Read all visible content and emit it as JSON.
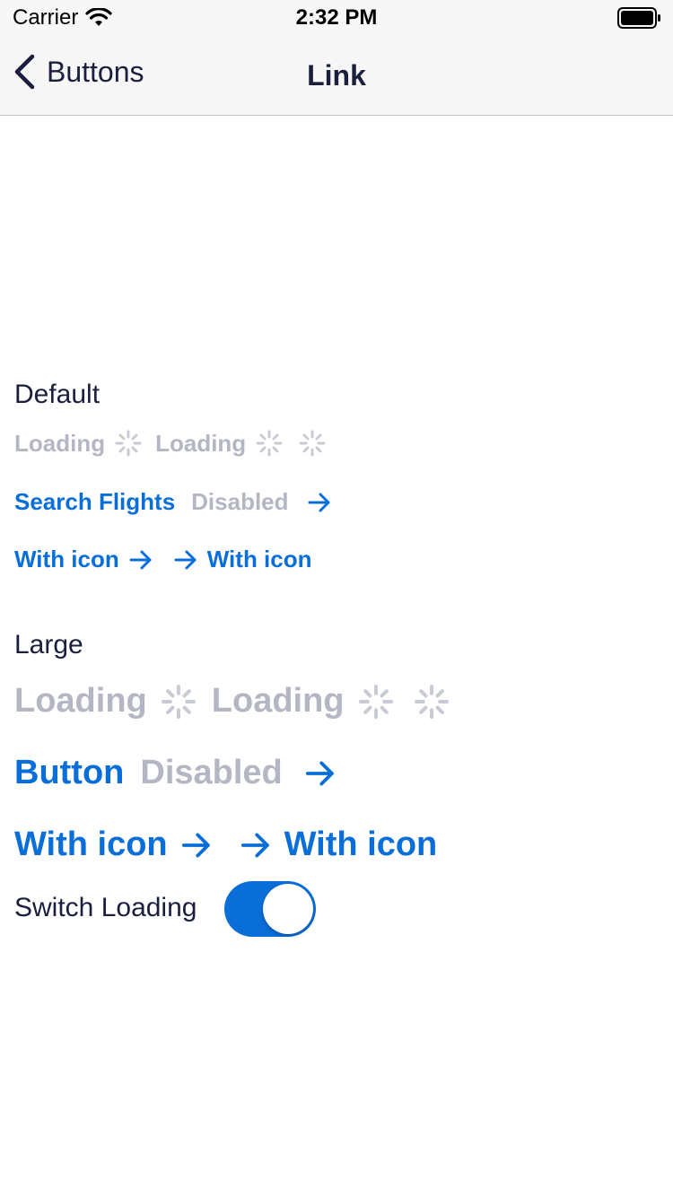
{
  "status_bar": {
    "carrier": "Carrier",
    "time": "2:32 PM"
  },
  "nav": {
    "back_label": "Buttons",
    "title": "Link"
  },
  "colors": {
    "link": "#0a6ed9",
    "disabled": "#b4b6c4",
    "text": "#1b1e3d"
  },
  "default_section": {
    "title": "Default",
    "loading_1": "Loading",
    "loading_2": "Loading",
    "search_flights": "Search Flights",
    "disabled": "Disabled",
    "with_icon_trailing": "With icon",
    "with_icon_leading": "With icon"
  },
  "large_section": {
    "title": "Large",
    "loading_1": "Loading",
    "loading_2": "Loading",
    "button": "Button",
    "disabled": "Disabled",
    "with_icon_trailing": "With icon",
    "with_icon_leading": "With icon"
  },
  "switch": {
    "label": "Switch Loading",
    "on": true
  },
  "icons": [
    "chevron-left-icon",
    "wifi-icon",
    "battery-icon",
    "arrow-right-icon",
    "spinner-icon"
  ]
}
